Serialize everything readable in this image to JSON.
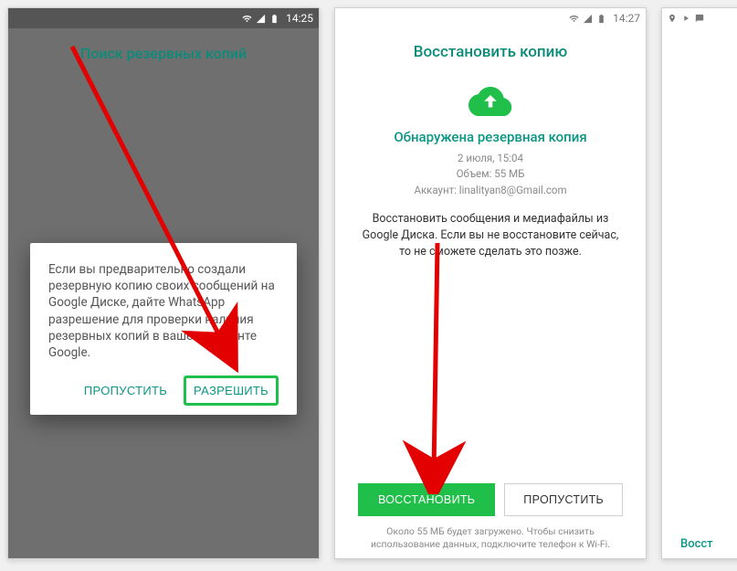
{
  "phone1": {
    "status": {
      "time": "14:25"
    },
    "title": "Поиск резервных копий",
    "dialog": {
      "text": "Если вы предварительно создали резервную копию своих сообщений на Google Диске, дайте WhatsApp разрешение для проверки наличия резервных копий в вашем аккаунте Google.",
      "skip": "ПРОПУСТИТЬ",
      "allow": "РАЗРЕШИТЬ"
    }
  },
  "phone2": {
    "status": {
      "time": "14:27"
    },
    "title": "Восстановить копию",
    "found_title": "Обнаружена резервная копия",
    "meta": {
      "date": "2 июля, 15:04",
      "size": "Объем: 55 МБ",
      "account": "Аккаунт: linalityan8@Gmail.com"
    },
    "description": "Восстановить сообщения и медиафайлы из Google Диска. Если вы не восстановите сейчас, то не сможете сделать это позже.",
    "restore": "ВОССТАНОВИТЬ",
    "skip": "ПРОПУСТИТЬ",
    "footer": "Около 55 МБ будет загружено. Чтобы снизить использование данных, подключите телефон к Wi-Fi."
  },
  "phone3": {
    "restore": "Восст"
  }
}
